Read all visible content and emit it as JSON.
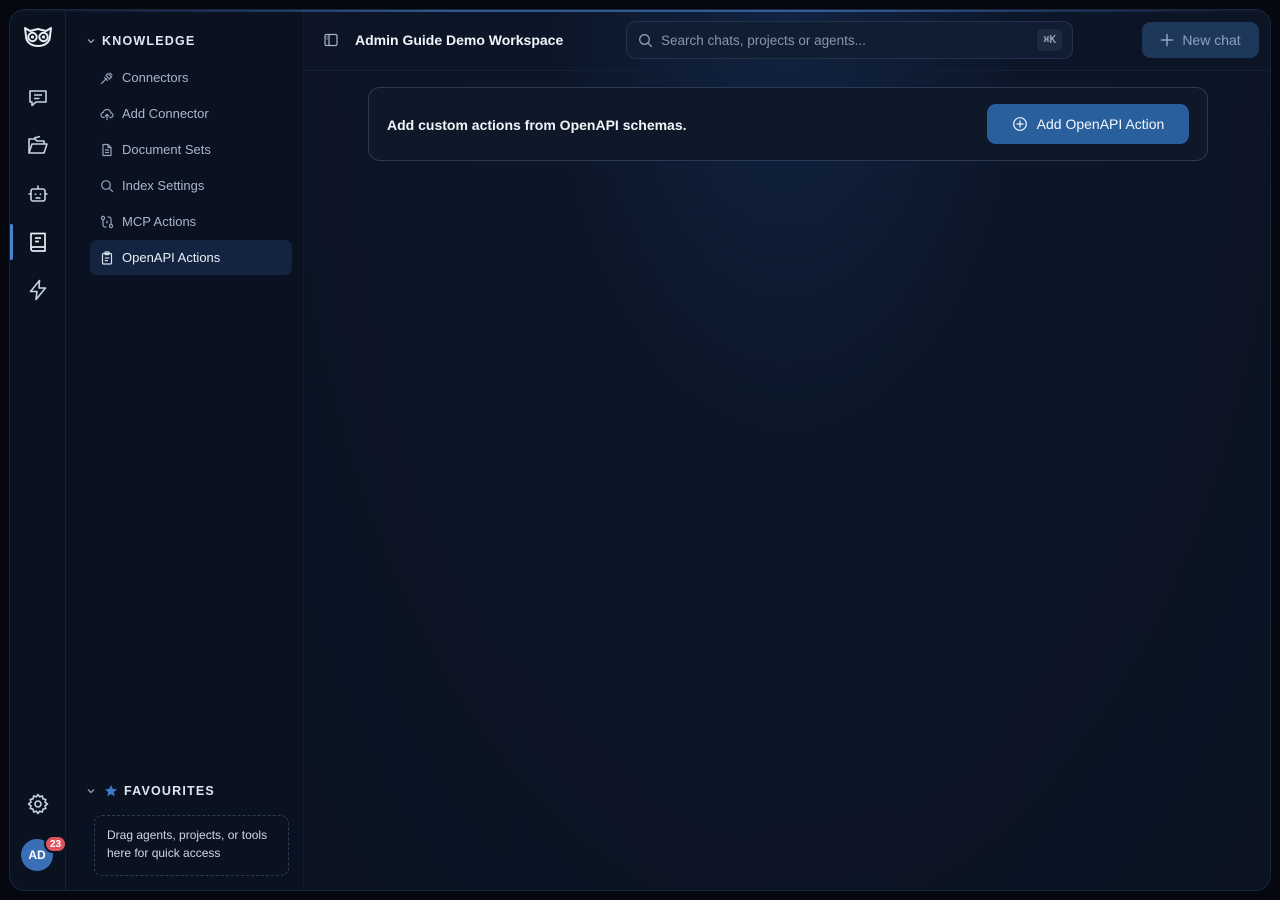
{
  "rail": {
    "items": [
      {
        "icon": "chat-icon"
      },
      {
        "icon": "folder-open-icon"
      },
      {
        "icon": "robot-icon"
      },
      {
        "icon": "book-icon",
        "active": true
      },
      {
        "icon": "lightning-icon"
      }
    ],
    "settings_icon": "gear-icon",
    "avatar_initials": "AD",
    "notification_count": "23"
  },
  "sidebar": {
    "section_title": "KNOWLEDGE",
    "items": [
      {
        "label": "Connectors",
        "icon": "plug-icon"
      },
      {
        "label": "Add Connector",
        "icon": "cloud-upload-icon"
      },
      {
        "label": "Document Sets",
        "icon": "documents-icon"
      },
      {
        "label": "Index Settings",
        "icon": "search-icon"
      },
      {
        "label": "MCP Actions",
        "icon": "route-icon"
      },
      {
        "label": "OpenAPI Actions",
        "icon": "clipboard-icon",
        "active": true
      }
    ],
    "favourites": {
      "title": "FAVOURITES",
      "hint": "Drag agents, projects, or tools here for quick access"
    }
  },
  "header": {
    "workspace_title": "Admin Guide Demo Workspace",
    "search_placeholder": "Search chats, projects or agents...",
    "search_shortcut": "⌘K",
    "new_chat_label": "New chat"
  },
  "main": {
    "card_text": "Add custom actions from OpenAPI schemas.",
    "add_button_label": "Add OpenAPI Action"
  },
  "colors": {
    "accent": "#2a5f9e",
    "active_item_bg": "#132440",
    "badge": "#e0545e",
    "background": "#0b1322"
  }
}
